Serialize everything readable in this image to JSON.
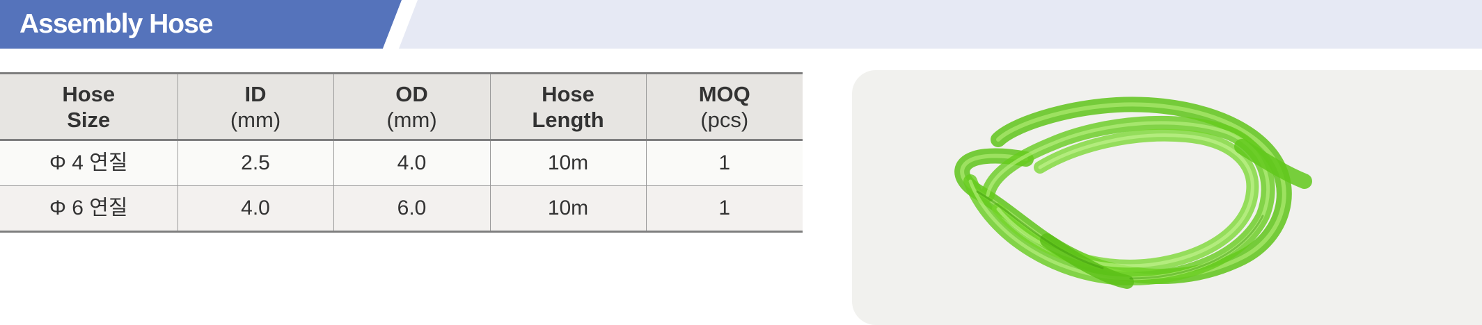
{
  "header": {
    "title": "Assembly Hose",
    "colors": {
      "banner": "#5573bb",
      "band": "#e6e9f4"
    }
  },
  "table": {
    "columns": [
      {
        "title": "Hose",
        "title2": "Size"
      },
      {
        "title": "ID",
        "unit": "(mm)"
      },
      {
        "title": "OD",
        "unit": "(mm)"
      },
      {
        "title": "Hose",
        "title2": "Length"
      },
      {
        "title": "MOQ",
        "unit": "(pcs)"
      }
    ],
    "rows": [
      [
        "Φ 4 연질",
        "2.5",
        "4.0",
        "10m",
        "1"
      ],
      [
        "Φ 6 연질",
        "4.0",
        "6.0",
        "10m",
        "1"
      ]
    ]
  },
  "photo": {
    "subject": "coiled-green-hose",
    "colors": {
      "panel": "#f1f1ee",
      "hose": "#6fd41f"
    }
  }
}
